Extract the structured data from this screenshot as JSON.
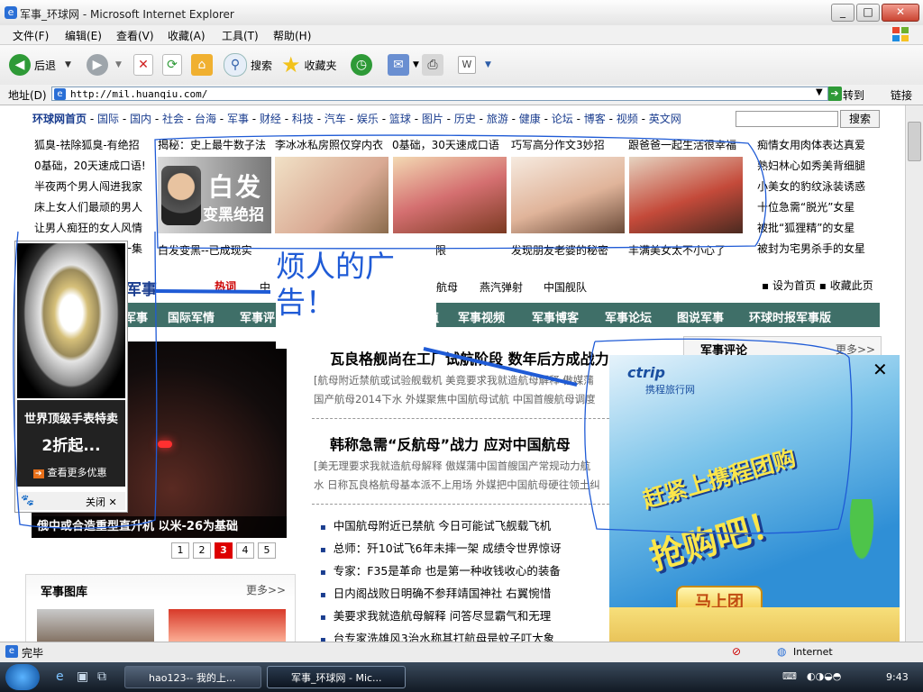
{
  "window": {
    "title": "军事_环球网 - Microsoft Internet Explorer",
    "minimize": "_",
    "maximize": "□",
    "close": "✕"
  },
  "menu": [
    "文件(F)",
    "编辑(E)",
    "查看(V)",
    "收藏(A)",
    "工具(T)",
    "帮助(H)"
  ],
  "toolbar": {
    "back": "后退",
    "search": "搜索",
    "favorites": "收藏夹"
  },
  "address": {
    "label": "地址(D)",
    "url": "http://mil.huanqiu.com/",
    "go": "转到",
    "links": "链接"
  },
  "site": {
    "nav_home": "环球网首页",
    "nav_items": [
      "国际",
      "国内",
      "社会",
      "台海",
      "军事",
      "财经",
      "科技",
      "汽车",
      "娱乐",
      "篮球",
      "图片",
      "历史",
      "旅游",
      "健康",
      "论坛",
      "博客",
      "视频",
      "英文网"
    ],
    "search_button": "搜索",
    "ad_left_links": [
      "狐臭-祛除狐臭-有绝招",
      "0基础，20天速成口语!",
      "半夜两个男人闯进我家",
      "床上女人们最顽的男人",
      "让男人痴狂的女人风情",
      "瘦身排毒美容三合一集"
    ],
    "ad_top_row": [
      "揭秘：史上最牛数子法",
      "李冰冰私房照仅穿内衣",
      "0基础，30天速成口语",
      "巧写高分作文3妙招",
      "跟爸爸一起生活很幸福"
    ],
    "ad_banner_text": "白发",
    "ad_banner_sub": "变黑绝招",
    "ad_bottom_row": [
      "白发变黑--已成现实",
      "",
      "装冲爆极限",
      "发现朋友老婆的秘密",
      "丰满美女太不小心了"
    ],
    "ad_right_links": [
      "痴情女用肉体表达真爱",
      "熟妇林心如秀美背细腿",
      "小美女的豹纹泳装诱惑",
      "十位急需“脱光”女星",
      "被批“狐狸精”的女星",
      "被封为宅男杀手的女星"
    ],
    "channel_label": "军事",
    "hot_label": "热词",
    "hot_words": [
      "中",
      "航母",
      "燕汽弹射",
      "中国舰队"
    ],
    "set_home": "设为首页",
    "add_fav": "收藏此页",
    "section_nav": [
      "军事",
      "国际军情",
      "军事评",
      "值",
      "军事视频",
      "军事博客",
      "军事论坛",
      "图说军事",
      "环球时报军事版"
    ],
    "headline1": "瓦良格舰尚在工厂试航阶段 数年后方成战力",
    "headline1_sub1": "[航母附近禁航或试验舰载机 美竟要求我就造航母解释 傲媒蒲",
    "headline1_sub2": "国产航母2014下水 外媒聚焦中国航母试航 中国首艘航母调度",
    "headline2": "韩称急需“反航母”战力 应对中国航母",
    "headline2_sub1": "[美无理要求我就造航母解释 傲媒蒲中国首艘国产常规动力航",
    "headline2_sub2": "水 日称瓦良格航母基本派不上用场 外媒把中国航母硬往领土纠",
    "bullets": [
      "中国航母附近已禁航 今日可能试飞舰载飞机",
      "总师：歼10试飞6年未摔一架 成绩令世界惊讶",
      "专家：F35是革命 也是第一种收钱收心的装备",
      "日内阁战败日明确不参拜靖国神社 右翼惋惜",
      "美要求我就造航母解释 问答尽显霸气和无理",
      "台专家洗雄风3治水称其打航母是蚊子叮大象"
    ],
    "feature_caption": "俄中或合造重型直升机 以米-26为基础",
    "pager": [
      "1",
      "2",
      "3",
      "4",
      "5"
    ],
    "gallery_title": "军事图库",
    "gallery_more": "更多>>",
    "comment_title": "军事评论",
    "comment_more": "更多>>"
  },
  "popup_watch": {
    "line1": "世界顶级手表特卖",
    "line2": "2折起...",
    "link": "查看更多优惠",
    "close": "关闭"
  },
  "popup_ctrip": {
    "brand": "ctrip",
    "brand_cn": "携程旅行网",
    "slogan1": "赶紧上携程团购",
    "slogan2": "抢购吧！",
    "button": "马上团",
    "close": "✕"
  },
  "annotation": {
    "line1": "烦人的广",
    "line2": "告！"
  },
  "status": {
    "text": "完毕",
    "zone": "Internet"
  },
  "taskbar": {
    "task1": "hao123-- 我的上...",
    "task2": "军事_环球网 - Mic...",
    "clock": "9:43"
  },
  "colors": {
    "section_green": "#3f6f68",
    "link_blue": "#1a3d8f",
    "hot_red": "#cc0000",
    "ctrip_bg": "#2f8fd6",
    "annotation_blue": "#1f5bd6"
  }
}
